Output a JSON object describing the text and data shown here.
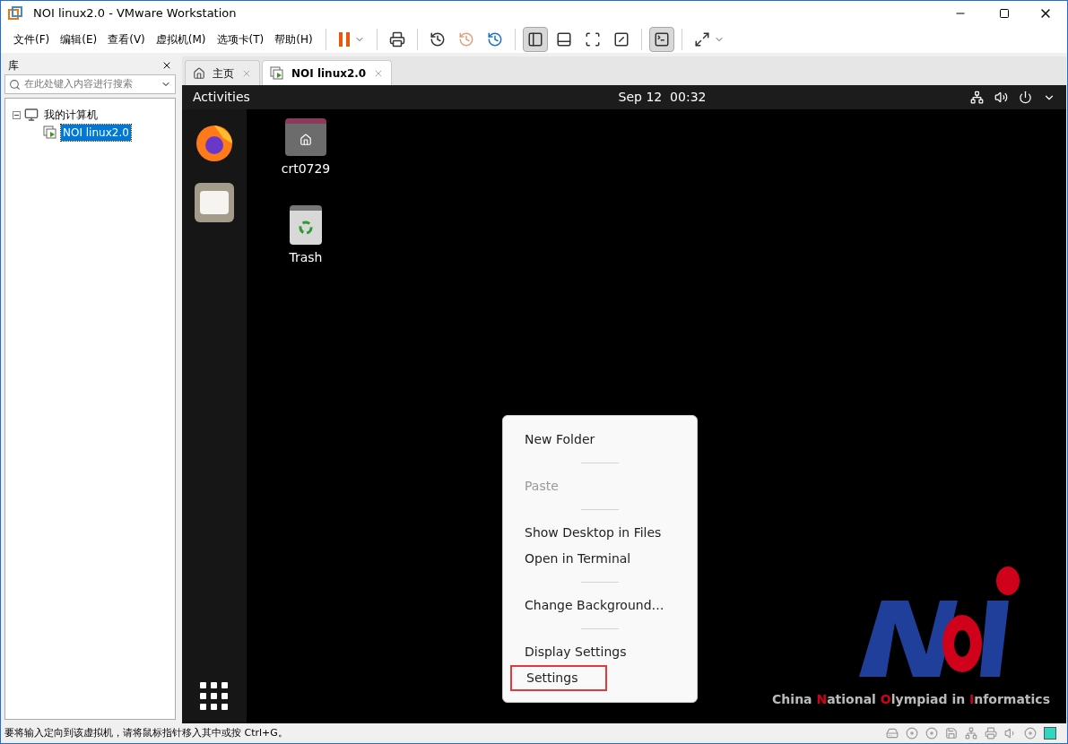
{
  "window": {
    "title": "NOI linux2.0 - VMware Workstation"
  },
  "menu_bar": [
    "文件(F)",
    "编辑(E)",
    "查看(V)",
    "虚拟机(M)",
    "选项卡(T)",
    "帮助(H)"
  ],
  "toolbar": [
    [
      {
        "kind": "pause",
        "selected": false
      }
    ],
    [
      {
        "kind": "send-keys",
        "selected": false
      }
    ],
    [
      {
        "kind": "snap-take",
        "selected": false
      },
      {
        "kind": "snap-revert",
        "selected": false
      },
      {
        "kind": "snap-manage",
        "selected": false
      }
    ],
    [
      {
        "kind": "view-library",
        "selected": true
      },
      {
        "kind": "view-thumb",
        "selected": false
      },
      {
        "kind": "view-full",
        "selected": false
      },
      {
        "kind": "view-unity",
        "selected": false
      }
    ],
    [
      {
        "kind": "console",
        "selected": true
      }
    ],
    [
      {
        "kind": "stretch",
        "selected": false
      }
    ]
  ],
  "library": {
    "title": "库",
    "search": {
      "placeholder": "在此处键入内容进行搜索"
    },
    "tree": [
      {
        "label": "我的计算机",
        "expanded": true,
        "children": [
          {
            "label": "NOI linux2.0",
            "selected": true
          }
        ]
      }
    ]
  },
  "tabs": [
    {
      "label": "主页",
      "kind": "home",
      "selected": false
    },
    {
      "label": "NOI linux2.0",
      "kind": "vm",
      "selected": true
    }
  ],
  "guest": {
    "activities": "Activities",
    "clock": "Sep 12  00:32",
    "dock": [
      {
        "kind": "firefox"
      },
      {
        "kind": "files"
      }
    ],
    "desktop_icons": [
      {
        "label": "crt0729",
        "kind": "home-folder"
      },
      {
        "label": "Trash",
        "kind": "trash"
      }
    ],
    "context_menu": [
      {
        "kind": "item",
        "label": "New Folder",
        "disabled": false,
        "outlined": false
      },
      {
        "kind": "separator"
      },
      {
        "kind": "item",
        "label": "Paste",
        "disabled": true,
        "outlined": false
      },
      {
        "kind": "separator"
      },
      {
        "kind": "item",
        "label": "Show Desktop in Files",
        "disabled": false,
        "outlined": false
      },
      {
        "kind": "item",
        "label": "Open in Terminal",
        "disabled": false,
        "outlined": false
      },
      {
        "kind": "separator"
      },
      {
        "kind": "item",
        "label": "Change Background…",
        "disabled": false,
        "outlined": false
      },
      {
        "kind": "separator"
      },
      {
        "kind": "item",
        "label": "Display Settings",
        "disabled": false,
        "outlined": false
      },
      {
        "kind": "item",
        "label": "Settings",
        "disabled": false,
        "outlined": true
      }
    ],
    "logo_caption": [
      {
        "text": "China ",
        "color": "#bbbbbb"
      },
      {
        "text": "N",
        "color": "#d0021b"
      },
      {
        "text": "ational ",
        "color": "#bbbbbb"
      },
      {
        "text": "O",
        "color": "#d0021b"
      },
      {
        "text": "lympiad in ",
        "color": "#bbbbbb"
      },
      {
        "text": "I",
        "color": "#d0021b"
      },
      {
        "text": "nformatics",
        "color": "#bbbbbb"
      }
    ]
  },
  "status_bar": {
    "text": "要将输入定向到该虚拟机，请将鼠标指针移入其中或按 Ctrl+G。"
  }
}
